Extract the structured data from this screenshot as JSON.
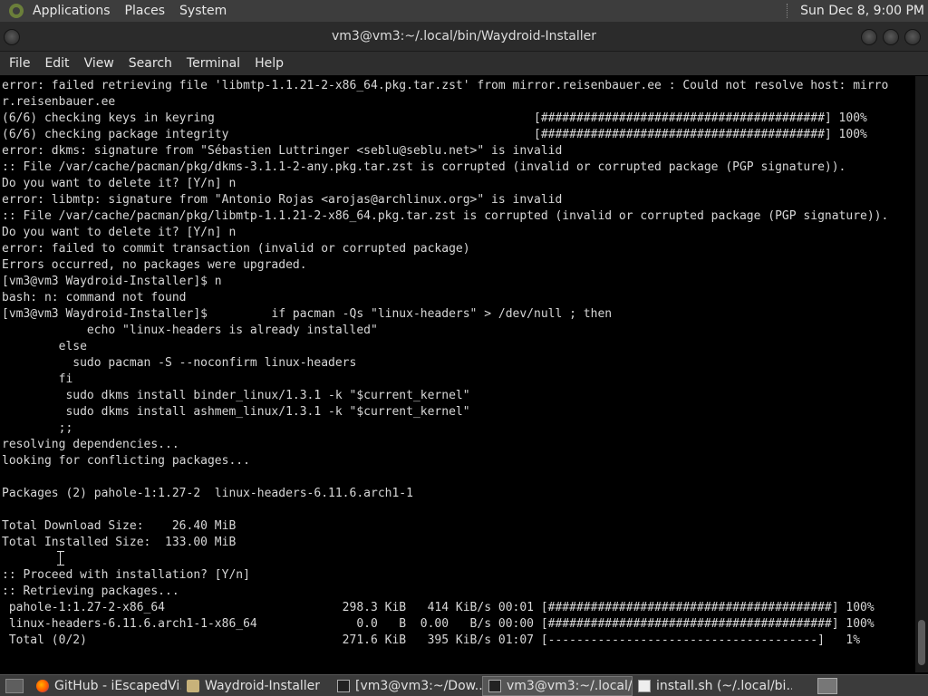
{
  "top_panel": {
    "applications": "Applications",
    "places": "Places",
    "system": "System",
    "clock": "Sun Dec  8,  9:00 PM"
  },
  "window": {
    "title": "vm3@vm3:~/.local/bin/Waydroid-Installer"
  },
  "menu": {
    "file": "File",
    "edit": "Edit",
    "view": "View",
    "search": "Search",
    "terminal": "Terminal",
    "help": "Help"
  },
  "terminal": {
    "lines": [
      "error: failed retrieving file 'libmtp-1.1.21-2-x86_64.pkg.tar.zst' from mirror.reisenbauer.ee : Could not resolve host: mirro",
      "r.reisenbauer.ee",
      "(6/6) checking keys in keyring                                             [########################################] 100%",
      "(6/6) checking package integrity                                           [########################################] 100%",
      "error: dkms: signature from \"Sébastien Luttringer <seblu@seblu.net>\" is invalid",
      ":: File /var/cache/pacman/pkg/dkms-3.1.1-2-any.pkg.tar.zst is corrupted (invalid or corrupted package (PGP signature)).",
      "Do you want to delete it? [Y/n] n",
      "error: libmtp: signature from \"Antonio Rojas <arojas@archlinux.org>\" is invalid",
      ":: File /var/cache/pacman/pkg/libmtp-1.1.21-2-x86_64.pkg.tar.zst is corrupted (invalid or corrupted package (PGP signature)).",
      "Do you want to delete it? [Y/n] n",
      "error: failed to commit transaction (invalid or corrupted package)",
      "Errors occurred, no packages were upgraded.",
      "[vm3@vm3 Waydroid-Installer]$ n",
      "bash: n: command not found",
      "[vm3@vm3 Waydroid-Installer]$         if pacman -Qs \"linux-headers\" > /dev/null ; then",
      "            echo \"linux-headers is already installed\"",
      "        else",
      "          sudo pacman -S --noconfirm linux-headers",
      "        fi",
      "         sudo dkms install binder_linux/1.3.1 -k \"$current_kernel\"",
      "         sudo dkms install ashmem_linux/1.3.1 -k \"$current_kernel\"",
      "        ;;",
      "resolving dependencies...",
      "looking for conflicting packages...",
      "",
      "Packages (2) pahole-1:1.27-2  linux-headers-6.11.6.arch1-1",
      "",
      "Total Download Size:    26.40 MiB",
      "Total Installed Size:  133.00 MiB",
      "",
      ":: Proceed with installation? [Y/n]",
      ":: Retrieving packages...",
      " pahole-1:1.27-2-x86_64                         298.3 KiB   414 KiB/s 00:01 [########################################] 100%",
      " linux-headers-6.11.6.arch1-1-x86_64              0.0   B  0.00   B/s 00:00 [########################################] 100%",
      " Total (0/2)                                    271.6 KiB   395 KiB/s 01:07 [--------------------------------------]   1%"
    ]
  },
  "taskbar": {
    "tasks": [
      {
        "label": "GitHub - iEscapedVi...",
        "icon": "firefox-icon"
      },
      {
        "label": "Waydroid-Installer",
        "icon": "folder-icon"
      },
      {
        "label": "[vm3@vm3:~/Dow...",
        "icon": "terminal-icon"
      },
      {
        "label": "vm3@vm3:~/.local/...",
        "icon": "terminal-icon"
      },
      {
        "label": "install.sh (~/.local/bi...",
        "icon": "text-editor-icon"
      }
    ]
  }
}
